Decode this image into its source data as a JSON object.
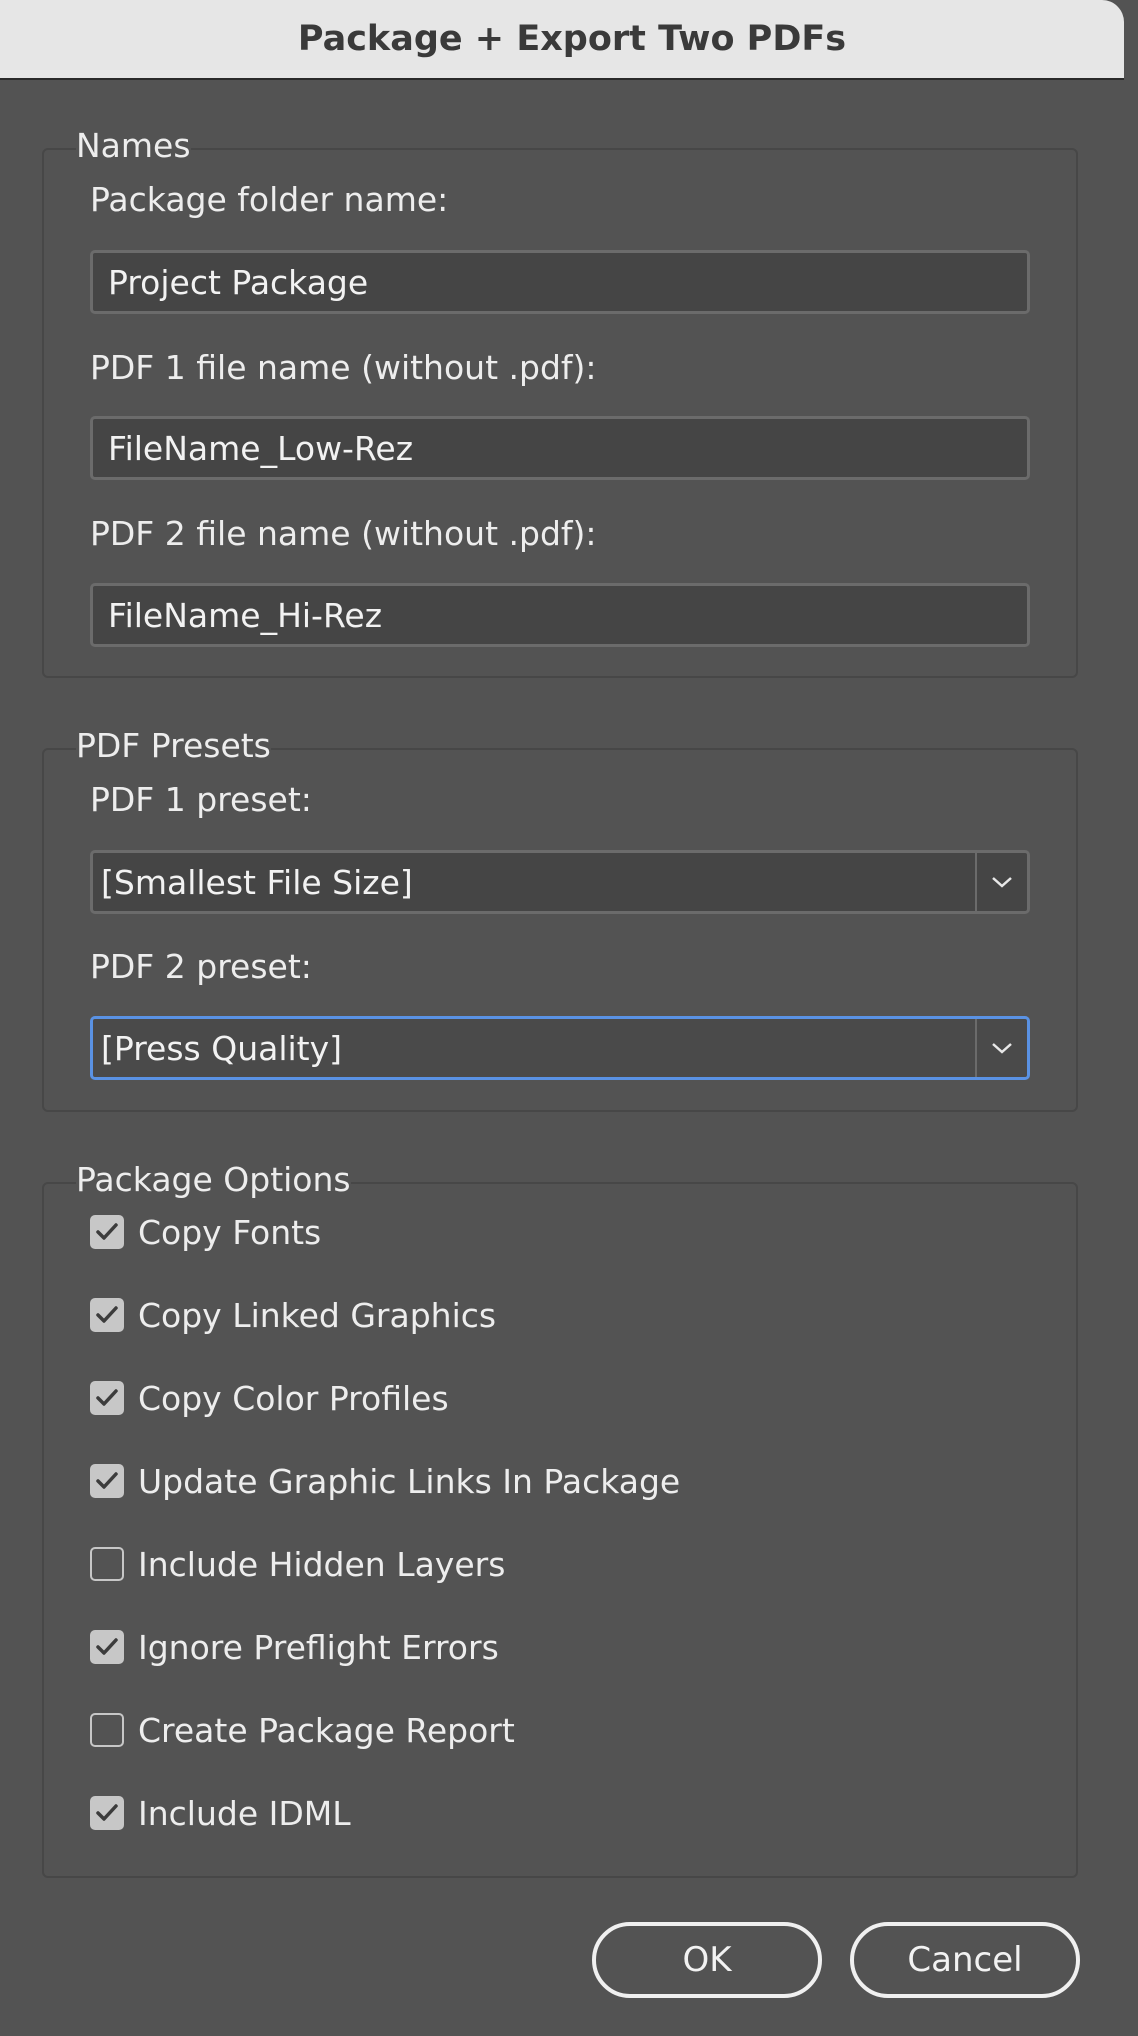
{
  "window": {
    "title": "Package + Export Two PDFs"
  },
  "names": {
    "title": "Names",
    "package_folder_label": "Package folder name:",
    "package_folder_value": "Project Package",
    "pdf1_name_label": "PDF 1 file name (without .pdf):",
    "pdf1_name_value": "FileName_Low-Rez",
    "pdf2_name_label": "PDF 2 file name (without .pdf):",
    "pdf2_name_value": "FileName_Hi-Rez"
  },
  "presets": {
    "title": "PDF Presets",
    "pdf1_label": "PDF 1 preset:",
    "pdf1_value": "[Smallest File Size]",
    "pdf2_label": "PDF 2 preset:",
    "pdf2_value": "[Press Quality]"
  },
  "options": {
    "title": "Package Options",
    "items": [
      {
        "label": "Copy Fonts",
        "checked": true
      },
      {
        "label": "Copy Linked Graphics",
        "checked": true
      },
      {
        "label": "Copy Color Profiles",
        "checked": true
      },
      {
        "label": "Update Graphic Links In Package",
        "checked": true
      },
      {
        "label": "Include Hidden Layers",
        "checked": false
      },
      {
        "label": "Ignore Preflight Errors",
        "checked": true
      },
      {
        "label": "Create Package Report",
        "checked": false
      },
      {
        "label": "Include IDML",
        "checked": true
      }
    ]
  },
  "buttons": {
    "ok": "OK",
    "cancel": "Cancel"
  },
  "colors": {
    "background": "#535353",
    "focus": "#5a92e4",
    "titlebar": "#e6e6e6"
  }
}
